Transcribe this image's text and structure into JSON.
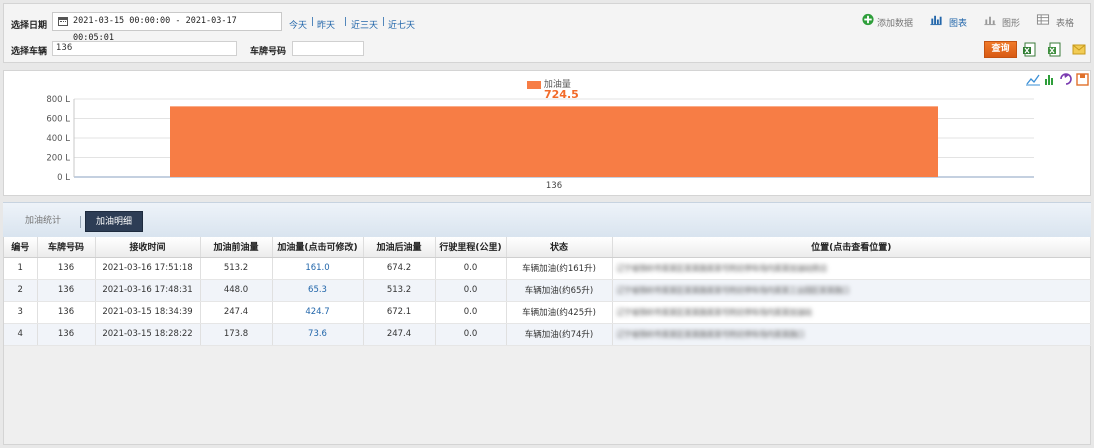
{
  "filter": {
    "date_label": "选择日期",
    "date_range": "2021-03-15 00:00:00 - 2021-03-17 00:05:01",
    "quick_ranges": [
      "今天",
      "昨天",
      "近三天",
      "近七天"
    ],
    "vehicle_label": "选择车辆",
    "vehicle_value": "136",
    "plate_label": "车牌号码",
    "plate_value": ""
  },
  "toolbar": {
    "add_data": "添加数据",
    "chart": "图表",
    "graph": "图形",
    "table": "表格",
    "query": "查询"
  },
  "colors": {
    "accent": "#2266aa",
    "bar": "#f77d45",
    "query": "#e36a1d",
    "tab_active": "#2d3d55"
  },
  "chart_data": {
    "type": "bar",
    "categories": [
      "136"
    ],
    "series": [
      {
        "name": "加油量",
        "values": [
          724.5
        ]
      }
    ],
    "data_labels": [
      "724.5"
    ],
    "y_ticks": [
      "0 L",
      "200 L",
      "400 L",
      "600 L",
      "800 L"
    ],
    "ylim": [
      0,
      800
    ],
    "grid": true,
    "legend_position": "top-center"
  },
  "tabs": [
    {
      "label": "加油统计",
      "active": false
    },
    {
      "label": "加油明细",
      "active": true
    }
  ],
  "table": {
    "columns": [
      "编号",
      "车牌号码",
      "接收时间",
      "加油前油量",
      "加油量(点击可修改)",
      "加油后油量",
      "行驶里程(公里)",
      "状态",
      "位置(点击查看位置)"
    ],
    "rows": [
      [
        "1",
        "136",
        "2021-03-16 17:51:18",
        "513.2",
        "161.0",
        "674.2",
        "0.0",
        "车辆加油(约161升)",
        "辽宁省铁岭市某某区某某路某某号附近停车场内某某加油站旁边"
      ],
      [
        "2",
        "136",
        "2021-03-16 17:48:31",
        "448.0",
        "65.3",
        "513.2",
        "0.0",
        "车辆加油(约65升)",
        "辽宁省铁岭市某某区某某路某某号附近停车场内某某工业园区某某路口"
      ],
      [
        "3",
        "136",
        "2021-03-15 18:34:39",
        "247.4",
        "424.7",
        "672.1",
        "0.0",
        "车辆加油(约425升)",
        "辽宁省铁岭市某某区某某路某某号附近停车场内某某加油站"
      ],
      [
        "4",
        "136",
        "2021-03-15 18:28:22",
        "173.8",
        "73.6",
        "247.4",
        "0.0",
        "车辆加油(约74升)",
        "辽宁省铁岭市某某区某某路某某号附近停车场内某某路口"
      ]
    ]
  }
}
